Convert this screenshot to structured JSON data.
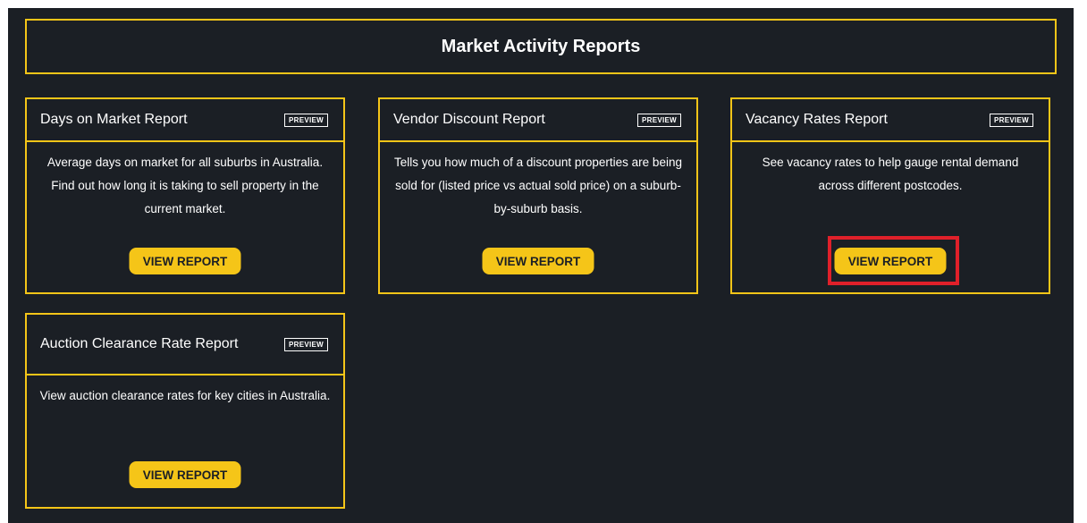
{
  "header": {
    "title": "Market Activity Reports"
  },
  "cards": [
    {
      "title": "Days on Market Report",
      "badge": "PREVIEW",
      "description": "Average days on market for all suburbs in Australia. Find out how long it is taking to sell property in the current market.",
      "button": "VIEW REPORT"
    },
    {
      "title": "Vendor Discount Report",
      "badge": "PREVIEW",
      "description": "Tells you how much of a discount properties are being sold for (listed price vs actual sold price) on a suburb-by-suburb basis.",
      "button": "VIEW REPORT"
    },
    {
      "title": "Vacancy Rates Report",
      "badge": "PREVIEW",
      "description": "See vacancy rates to help gauge rental demand across different postcodes.",
      "button": "VIEW REPORT"
    },
    {
      "title": "Auction Clearance Rate Report",
      "badge": "PREVIEW",
      "description": "View auction clearance rates for key cities in Australia.",
      "button": "VIEW REPORT"
    }
  ],
  "colors": {
    "accent": "#f5c518",
    "background": "#1b1f25",
    "highlight": "#e0202a"
  }
}
